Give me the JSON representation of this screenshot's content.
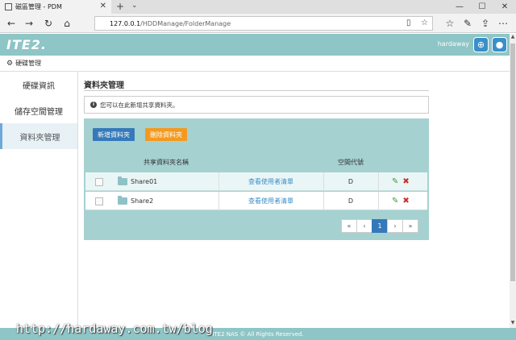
{
  "browser": {
    "tab_title": "磁區管理 - PDM",
    "url_host": "127.0.0.1",
    "url_path": "/HDDManage/FolderManage"
  },
  "header": {
    "logo": "ITE2.",
    "username": "hardaway"
  },
  "breadcrumb": {
    "label": "硬碟管理"
  },
  "sidebar": {
    "items": [
      {
        "label": "硬碟資訊"
      },
      {
        "label": "儲存空間管理"
      },
      {
        "label": "資料夾管理"
      }
    ]
  },
  "main": {
    "title": "資料夾管理",
    "info": "您可以在此新增共享資料夾。",
    "add_button": "新增資料夾",
    "delete_button": "刪除資料夾",
    "columns": {
      "name": "共享資料夾名稱",
      "drive": "空間代號"
    },
    "rows": [
      {
        "name": "Share01",
        "link": "查看使用者清單",
        "drive": "D"
      },
      {
        "name": "Share2",
        "link": "查看使用者清單",
        "drive": "D"
      }
    ],
    "pagination": {
      "current": "1"
    }
  },
  "footer": {
    "text": "ITE2 NAS © All Rights Reserved."
  },
  "watermark": "http://hardaway.com.tw/blog",
  "colors": {
    "header_bg": "#8ec5c6",
    "panel_bg": "#a6d1d1",
    "primary": "#3579b9",
    "warning": "#f39a1e"
  }
}
